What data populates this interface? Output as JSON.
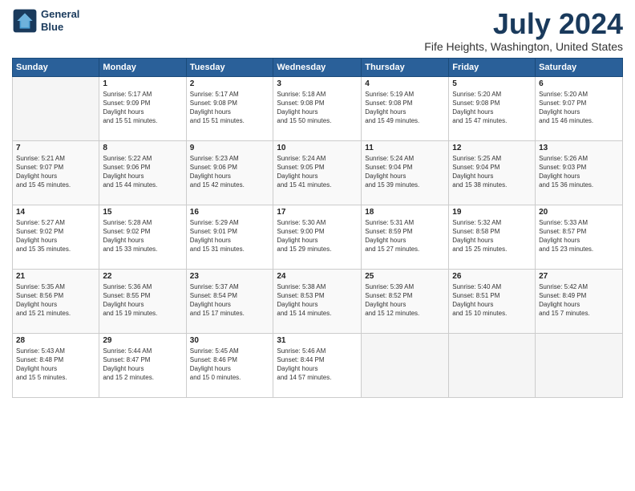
{
  "header": {
    "logo_line1": "General",
    "logo_line2": "Blue",
    "month": "July 2024",
    "location": "Fife Heights, Washington, United States"
  },
  "weekdays": [
    "Sunday",
    "Monday",
    "Tuesday",
    "Wednesday",
    "Thursday",
    "Friday",
    "Saturday"
  ],
  "weeks": [
    [
      {
        "day": "",
        "empty": true
      },
      {
        "day": "1",
        "sunrise": "5:17 AM",
        "sunset": "9:09 PM",
        "daylight": "15 hours and 51 minutes."
      },
      {
        "day": "2",
        "sunrise": "5:17 AM",
        "sunset": "9:08 PM",
        "daylight": "15 hours and 51 minutes."
      },
      {
        "day": "3",
        "sunrise": "5:18 AM",
        "sunset": "9:08 PM",
        "daylight": "15 hours and 50 minutes."
      },
      {
        "day": "4",
        "sunrise": "5:19 AM",
        "sunset": "9:08 PM",
        "daylight": "15 hours and 49 minutes."
      },
      {
        "day": "5",
        "sunrise": "5:20 AM",
        "sunset": "9:08 PM",
        "daylight": "15 hours and 47 minutes."
      },
      {
        "day": "6",
        "sunrise": "5:20 AM",
        "sunset": "9:07 PM",
        "daylight": "15 hours and 46 minutes."
      }
    ],
    [
      {
        "day": "7",
        "sunrise": "5:21 AM",
        "sunset": "9:07 PM",
        "daylight": "15 hours and 45 minutes."
      },
      {
        "day": "8",
        "sunrise": "5:22 AM",
        "sunset": "9:06 PM",
        "daylight": "15 hours and 44 minutes."
      },
      {
        "day": "9",
        "sunrise": "5:23 AM",
        "sunset": "9:06 PM",
        "daylight": "15 hours and 42 minutes."
      },
      {
        "day": "10",
        "sunrise": "5:24 AM",
        "sunset": "9:05 PM",
        "daylight": "15 hours and 41 minutes."
      },
      {
        "day": "11",
        "sunrise": "5:24 AM",
        "sunset": "9:04 PM",
        "daylight": "15 hours and 39 minutes."
      },
      {
        "day": "12",
        "sunrise": "5:25 AM",
        "sunset": "9:04 PM",
        "daylight": "15 hours and 38 minutes."
      },
      {
        "day": "13",
        "sunrise": "5:26 AM",
        "sunset": "9:03 PM",
        "daylight": "15 hours and 36 minutes."
      }
    ],
    [
      {
        "day": "14",
        "sunrise": "5:27 AM",
        "sunset": "9:02 PM",
        "daylight": "15 hours and 35 minutes."
      },
      {
        "day": "15",
        "sunrise": "5:28 AM",
        "sunset": "9:02 PM",
        "daylight": "15 hours and 33 minutes."
      },
      {
        "day": "16",
        "sunrise": "5:29 AM",
        "sunset": "9:01 PM",
        "daylight": "15 hours and 31 minutes."
      },
      {
        "day": "17",
        "sunrise": "5:30 AM",
        "sunset": "9:00 PM",
        "daylight": "15 hours and 29 minutes."
      },
      {
        "day": "18",
        "sunrise": "5:31 AM",
        "sunset": "8:59 PM",
        "daylight": "15 hours and 27 minutes."
      },
      {
        "day": "19",
        "sunrise": "5:32 AM",
        "sunset": "8:58 PM",
        "daylight": "15 hours and 25 minutes."
      },
      {
        "day": "20",
        "sunrise": "5:33 AM",
        "sunset": "8:57 PM",
        "daylight": "15 hours and 23 minutes."
      }
    ],
    [
      {
        "day": "21",
        "sunrise": "5:35 AM",
        "sunset": "8:56 PM",
        "daylight": "15 hours and 21 minutes."
      },
      {
        "day": "22",
        "sunrise": "5:36 AM",
        "sunset": "8:55 PM",
        "daylight": "15 hours and 19 minutes."
      },
      {
        "day": "23",
        "sunrise": "5:37 AM",
        "sunset": "8:54 PM",
        "daylight": "15 hours and 17 minutes."
      },
      {
        "day": "24",
        "sunrise": "5:38 AM",
        "sunset": "8:53 PM",
        "daylight": "15 hours and 14 minutes."
      },
      {
        "day": "25",
        "sunrise": "5:39 AM",
        "sunset": "8:52 PM",
        "daylight": "15 hours and 12 minutes."
      },
      {
        "day": "26",
        "sunrise": "5:40 AM",
        "sunset": "8:51 PM",
        "daylight": "15 hours and 10 minutes."
      },
      {
        "day": "27",
        "sunrise": "5:42 AM",
        "sunset": "8:49 PM",
        "daylight": "15 hours and 7 minutes."
      }
    ],
    [
      {
        "day": "28",
        "sunrise": "5:43 AM",
        "sunset": "8:48 PM",
        "daylight": "15 hours and 5 minutes."
      },
      {
        "day": "29",
        "sunrise": "5:44 AM",
        "sunset": "8:47 PM",
        "daylight": "15 hours and 2 minutes."
      },
      {
        "day": "30",
        "sunrise": "5:45 AM",
        "sunset": "8:46 PM",
        "daylight": "15 hours and 0 minutes."
      },
      {
        "day": "31",
        "sunrise": "5:46 AM",
        "sunset": "8:44 PM",
        "daylight": "14 hours and 57 minutes."
      },
      {
        "day": "",
        "empty": true
      },
      {
        "day": "",
        "empty": true
      },
      {
        "day": "",
        "empty": true
      }
    ]
  ]
}
